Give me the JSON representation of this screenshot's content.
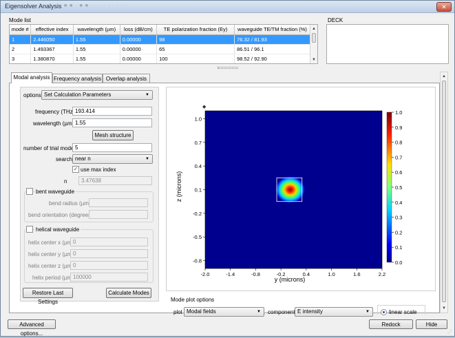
{
  "window": {
    "title": "Eigensolver Analysis",
    "faded_title": "■ ■ · ■ ■ ·   ·   ·   ·   ·   ·   ·   ·   ·",
    "close_glyph": "✕"
  },
  "mode_list": {
    "label": "Mode list",
    "columns": [
      "mode #",
      "effective index",
      "wavelength (µm)",
      "loss (dB/cm)",
      "TE polarization fraction (Ey)",
      "waveguide TE/TM fraction (%)"
    ],
    "rows": [
      [
        "1",
        "2.446050",
        "1.55",
        "0.00000",
        "98",
        "76.32 / 81.93"
      ],
      [
        "2",
        "1.493367",
        "1.55",
        "0.00000",
        "65",
        "86.51 / 96.1"
      ],
      [
        "3",
        "1.380870",
        "1.55",
        "0.00000",
        "100",
        "98.52 / 92.90"
      ]
    ],
    "selected_row": 0
  },
  "deck": {
    "label": "DECK"
  },
  "tabs": [
    {
      "label": "Modal analysis",
      "active": true
    },
    {
      "label": "Frequency analysis",
      "active": false
    },
    {
      "label": "Overlap analysis",
      "active": false
    }
  ],
  "options": {
    "label": "options",
    "value": "Set Calculation Parameters",
    "frequency_label": "frequency (THz)",
    "frequency_value": "193.414",
    "wavelength_label": "wavelength (µm)",
    "wavelength_value": "1.55",
    "mesh_button": "Mesh structure",
    "trial_modes_label": "number of trial modes",
    "trial_modes_value": "5",
    "search_label": "search",
    "search_value": "near n",
    "use_max_index_label": "use max index",
    "n_label": "n",
    "n_value": "3.47638",
    "bent_label": "bent waveguide",
    "bend_radius_label": "bend radius (µm)",
    "bend_orientation_label": "bend orientation (degrees)",
    "helical_label": "helical waveguide",
    "helix_x_label": "helix center x (µm)",
    "helix_x_value": "0",
    "helix_y_label": "helix center y (µm)",
    "helix_y_value": "0",
    "helix_z_label": "helix center z (µm)",
    "helix_z_value": "0",
    "helix_period_label": "helix period (µm)",
    "helix_period_value": "100000",
    "restore_button": "Restore Last Settings",
    "calculate_button": "Calculate Modes"
  },
  "plot_options": {
    "label": "Mode plot options",
    "plot_label": "plot",
    "plot_value": "Modal fields",
    "component_label": "component",
    "component_value": "E intensity",
    "scale_label": "linear scale"
  },
  "footer": {
    "advanced_button": "Advanced options...",
    "redock_button": "Redock",
    "hide_button": "Hide"
  },
  "chart_data": {
    "type": "heatmap",
    "title": "",
    "xlabel": "y (microns)",
    "ylabel": "z (microns)",
    "x_ticks": [
      "-2.0",
      "-1.4",
      "-0.8",
      "-0.2",
      "0.4",
      "1.0",
      "1.6",
      "2.2"
    ],
    "y_ticks": [
      "1.0",
      "0.7",
      "0.4",
      "0.1",
      "-0.2",
      "-0.5",
      "-0.8"
    ],
    "colorbar_ticks": [
      "1.0",
      "0.9",
      "0.8",
      "0.7",
      "0.6",
      "0.5",
      "0.4",
      "0.3",
      "0.2",
      "0.1",
      "0.0"
    ],
    "xlim": [
      -2.0,
      2.2
    ],
    "ylim": [
      -0.9,
      1.1
    ],
    "colorbar_range": [
      0.0,
      1.0
    ],
    "peak_center": {
      "y": 0.02,
      "z": 0.1
    },
    "waveguide_outline": {
      "y": [
        -0.3,
        0.3
      ],
      "z": [
        -0.05,
        0.25
      ]
    },
    "colors": {
      "background": "#00008f",
      "peak": "#8b0000"
    }
  }
}
